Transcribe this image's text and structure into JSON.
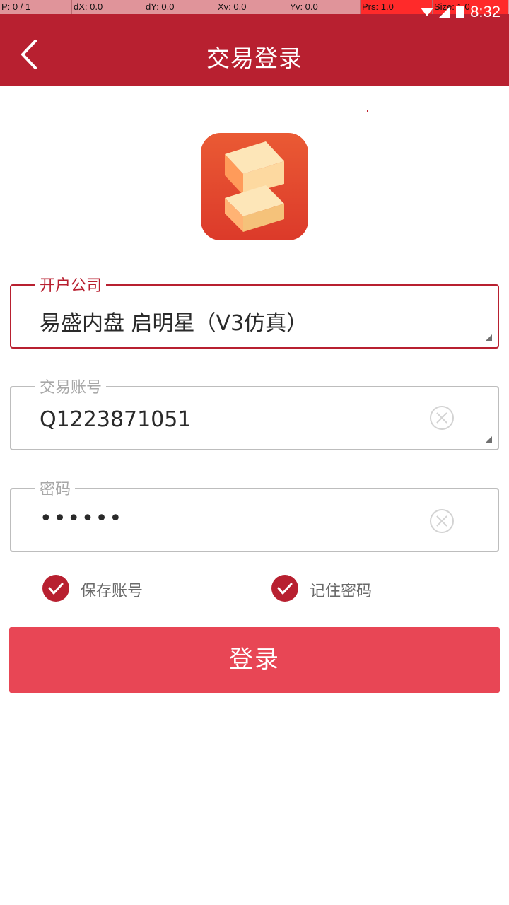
{
  "debug": {
    "p": "P: 0 / 1",
    "dx": "dX: 0.0",
    "dy": "dY: 0.0",
    "xv": "Xv: 0.0",
    "yv": "Yv: 0.0",
    "prs": "Prs: 1.0",
    "size": "Size: 1.0"
  },
  "status": {
    "time": "8:32"
  },
  "header": {
    "title": "交易登录"
  },
  "form": {
    "company": {
      "label": "开户公司",
      "value": "易盛内盘 启明星（V3仿真）"
    },
    "account": {
      "label": "交易账号",
      "value": "Q1223871051"
    },
    "password": {
      "label": "密码",
      "value": "••••••"
    }
  },
  "options": {
    "save_account": {
      "label": "保存账号",
      "checked": true
    },
    "remember_password": {
      "label": "记住密码",
      "checked": true
    }
  },
  "login_button": {
    "label": "登录"
  },
  "colors": {
    "brand": "#b82030",
    "button": "#e84655"
  }
}
